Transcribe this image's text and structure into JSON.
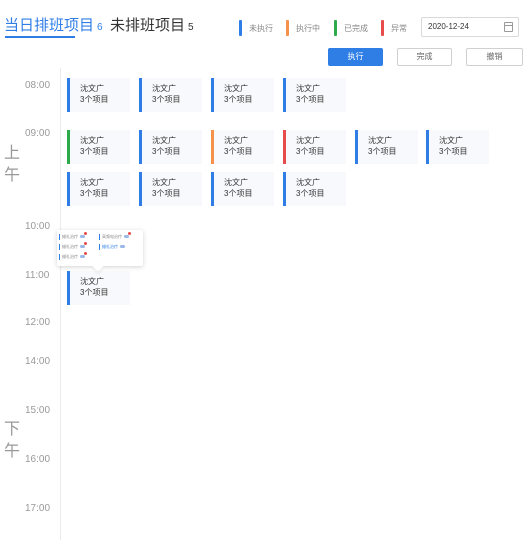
{
  "tabs": {
    "active": {
      "label": "当日排班项目",
      "count": "6"
    },
    "inactive": {
      "label": "未排班项目",
      "count": "5"
    }
  },
  "legend": [
    {
      "label": "未执行",
      "color": "#2f7ee6"
    },
    {
      "label": "执行中",
      "color": "#f5914a"
    },
    {
      "label": "已完成",
      "color": "#2eaa4a"
    },
    {
      "label": "异常",
      "color": "#e84b4b"
    }
  ],
  "date": {
    "value": "2020-12-24",
    "icon": "calendar-icon"
  },
  "actions": {
    "execute": "执行",
    "complete": "完成",
    "cancel": "撤销"
  },
  "periods": {
    "morning": [
      "上",
      "午"
    ],
    "afternoon": [
      "下",
      "午"
    ]
  },
  "times": [
    "08:00",
    "09:00",
    "10:00",
    "11:00",
    "12:00",
    "14:00",
    "15:00",
    "16:00",
    "17:00"
  ],
  "card_text": {
    "name": "沈文广",
    "items": "3个项目"
  },
  "cards": [
    {
      "name": "沈文广",
      "items": "3个项目",
      "status": "未执行",
      "color": "#2f7ee6"
    },
    {
      "name": "沈文广",
      "items": "3个项目",
      "status": "未执行",
      "color": "#2f7ee6"
    },
    {
      "name": "沈文广",
      "items": "3个项目",
      "status": "未执行",
      "color": "#2f7ee6"
    },
    {
      "name": "沈文广",
      "items": "3个项目",
      "status": "未执行",
      "color": "#2f7ee6"
    },
    {
      "name": "沈文广",
      "items": "3个项目",
      "status": "已完成",
      "color": "#2eaa4a"
    },
    {
      "name": "沈文广",
      "items": "3个项目",
      "status": "未执行",
      "color": "#2f7ee6"
    },
    {
      "name": "沈文广",
      "items": "3个项目",
      "status": "执行中",
      "color": "#f5914a"
    },
    {
      "name": "沈文广",
      "items": "3个项目",
      "status": "异常",
      "color": "#e84b4b"
    },
    {
      "name": "沈文广",
      "items": "3个项目",
      "status": "未执行",
      "color": "#2f7ee6"
    },
    {
      "name": "沈文广",
      "items": "3个项目",
      "status": "未执行",
      "color": "#2f7ee6"
    },
    {
      "name": "沈文广",
      "items": "3个项目",
      "status": "未执行",
      "color": "#2f7ee6"
    },
    {
      "name": "沈文广",
      "items": "3个项目",
      "status": "未执行",
      "color": "#2f7ee6"
    },
    {
      "name": "沈文广",
      "items": "3个项目",
      "status": "未执行",
      "color": "#2f7ee6"
    },
    {
      "name": "沈文广",
      "items": "3个项目",
      "status": "未执行",
      "color": "#2f7ee6"
    },
    {
      "name": "沈文广",
      "items": "3个项目",
      "status": "未执行",
      "color": "#2f7ee6"
    }
  ],
  "popup": {
    "items": [
      "蜡礼治疗",
      "高频电治疗",
      "蜡礼治疗",
      "蜡礼治疗",
      "蜡礼治疗"
    ]
  }
}
